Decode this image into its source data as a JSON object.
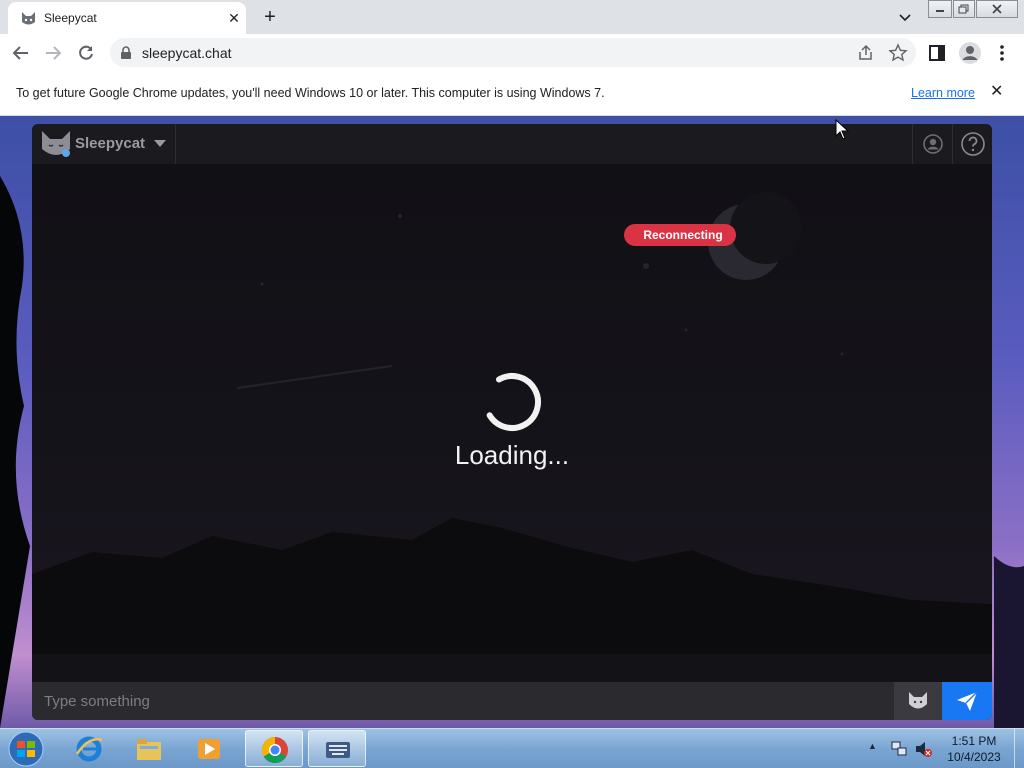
{
  "browser": {
    "tab_title": "Sleepycat",
    "tab_close": "✕",
    "new_tab": "+",
    "url": "sleepycat.chat"
  },
  "infobar": {
    "message": "To get future Google Chrome updates, you'll need Windows 10 or later. This computer is using Windows 7.",
    "link_label": "Learn more",
    "close": "✕"
  },
  "app": {
    "brand": "Sleepycat",
    "status_badge": "Reconnecting",
    "loading_text": "Loading...",
    "input_placeholder": "Type something",
    "colors": {
      "badge": "#d93344",
      "send": "#1877f2",
      "background": "#131216"
    }
  },
  "taskbar": {
    "time": "1:51 PM",
    "date": "10/4/2023",
    "pinned": [
      "internet-explorer",
      "file-explorer",
      "media-player",
      "chrome",
      "on-screen-keyboard"
    ]
  }
}
